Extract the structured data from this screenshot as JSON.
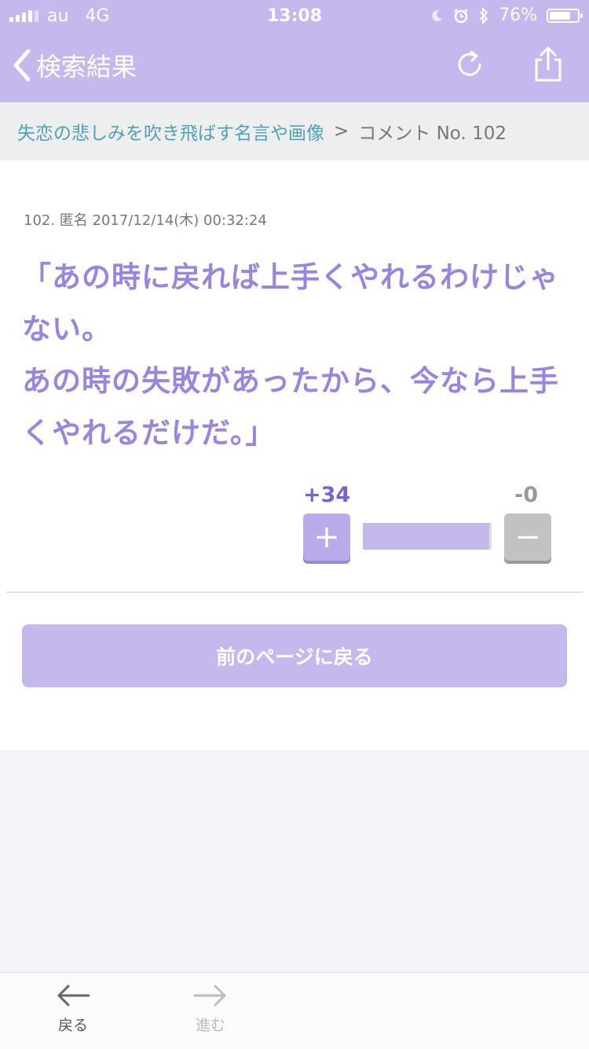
{
  "status_bar": {
    "carrier": "au   4G",
    "time": "13:08",
    "battery_percent": "76%",
    "battery_level": 0.76
  },
  "navbar": {
    "back_label": "検索結果"
  },
  "breadcrumb": {
    "link": "失恋の悲しみを吹き飛ばす名言や画像",
    "separator": ">",
    "current": "コメント No. 102"
  },
  "comment": {
    "meta": "102. 匿名 2017/12/14(木) 00:32:24",
    "lines": [
      "「あの時に戻れば上手くやれるわけじゃない。",
      "あの時の失敗があったから、今なら上手くやれるだけだ。」"
    ],
    "plus_count": "+34",
    "minus_count": "-0",
    "plus_label": "+",
    "minus_label": "−"
  },
  "prev_button": "前のページに戻る",
  "toolbar": {
    "back_label": "戻る",
    "forward_label": "進む"
  },
  "colors": {
    "accent": "#c4b8ed",
    "comment_text": "#9b84e0",
    "link": "#4fa1b8"
  }
}
